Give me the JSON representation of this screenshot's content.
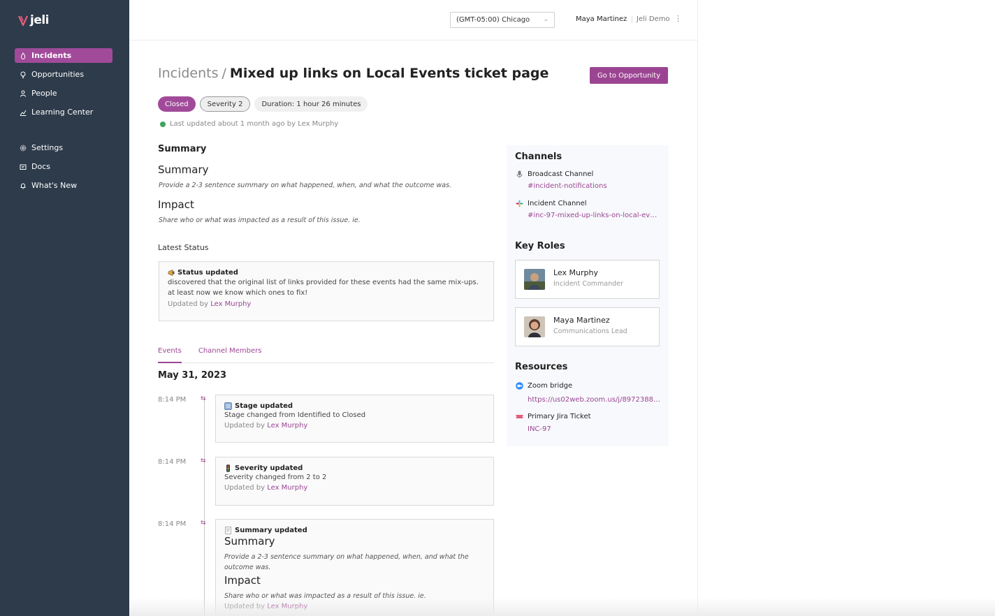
{
  "brand": {
    "name": "jeli"
  },
  "sidebar": {
    "main": [
      {
        "label": "Incidents",
        "icon": "flame-icon",
        "active": true
      },
      {
        "label": "Opportunities",
        "icon": "lightbulb-icon",
        "active": false
      },
      {
        "label": "People",
        "icon": "person-icon",
        "active": false
      },
      {
        "label": "Learning Center",
        "icon": "chart-icon",
        "active": false
      }
    ],
    "secondary": [
      {
        "label": "Settings",
        "icon": "gear-icon"
      },
      {
        "label": "Docs",
        "icon": "docs-icon"
      },
      {
        "label": "What's New",
        "icon": "bell-icon"
      }
    ]
  },
  "topbar": {
    "timezone": "(GMT-05:00) Chicago",
    "user": "Maya Martinez",
    "org": "Jeli Demo"
  },
  "header": {
    "breadcrumb_root": "Incidents",
    "separator": "/",
    "title": "Mixed up links on Local Events ticket page",
    "action_button": "Go to Opportunity"
  },
  "badges": {
    "status": "Closed",
    "severity": "Severity 2",
    "duration": "Duration: 1 hour 26 minutes"
  },
  "last_updated": "Last updated about 1 month ago by Lex Murphy",
  "summary": {
    "section_title": "Summary",
    "summary_heading": "Summary",
    "summary_text": "Provide a 2-3 sentence summary on what happened, when, and what the outcome was.",
    "impact_heading": "Impact",
    "impact_text": "Share who or what was impacted as a result of this issue. ie."
  },
  "latest_status": {
    "label": "Latest Status",
    "head": "Status updated",
    "body": "discovered that the original list of links provided for these events had the same mix-ups. at least now we know which ones to fix!",
    "updated_by_prefix": "Updated by",
    "updated_by": "Lex Murphy"
  },
  "tabs": [
    {
      "label": "Events",
      "active": true
    },
    {
      "label": "Channel Members",
      "active": false
    }
  ],
  "events_date": "May 31, 2023",
  "events": [
    {
      "time": "8:14 PM",
      "head": "Stage updated",
      "body": "Stage changed from Identified to Closed",
      "updated_by_prefix": "Updated by",
      "updated_by": "Lex Murphy"
    },
    {
      "time": "8:14 PM",
      "head": "Severity updated",
      "body": "Severity changed from 2 to 2",
      "updated_by_prefix": "Updated by",
      "updated_by": "Lex Murphy"
    },
    {
      "time": "8:14 PM",
      "head": "Summary updated",
      "summary_heading": "Summary",
      "summary_text": "Provide a 2-3 sentence summary on what happened, when, and what the outcome was.",
      "impact_heading": "Impact",
      "impact_text": "Share who or what was impacted as a result of this issue. ie.",
      "updated_by_prefix": "Updated by",
      "updated_by": "Lex Murphy"
    }
  ],
  "channels": {
    "title": "Channels",
    "broadcast_label": "Broadcast Channel",
    "broadcast_link": "#incident-notifications",
    "incident_label": "Incident Channel",
    "incident_link": "#inc-97-mixed-up-links-on-local-eve..."
  },
  "key_roles": {
    "title": "Key Roles",
    "roles": [
      {
        "name": "Lex Murphy",
        "role": "Incident Commander"
      },
      {
        "name": "Maya Martinez",
        "role": "Communications Lead"
      }
    ]
  },
  "resources": {
    "title": "Resources",
    "zoom_label": "Zoom bridge",
    "zoom_link": "https://us02web.zoom.us/j/89723886...",
    "jira_label": "Primary Jira Ticket",
    "jira_link": "INC-97"
  },
  "colors": {
    "sidebar": "#2d3b4b",
    "accent": "#9b4592",
    "success": "#3da35d"
  }
}
